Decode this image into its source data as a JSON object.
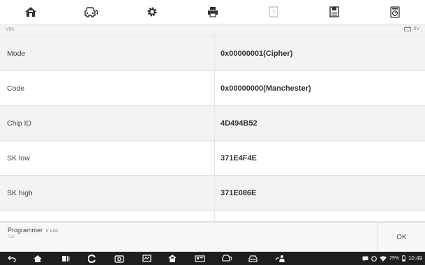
{
  "toolbar": {
    "icons": [
      "home-icon",
      "vehicle-swap-icon",
      "settings-icon",
      "print-icon",
      "help-icon",
      "save-icon",
      "datalogging-icon"
    ]
  },
  "vin_bar": {
    "vin_label": "VIN:",
    "voltage": "0V"
  },
  "rows": [
    {
      "label": "Mode",
      "value": "0x00000001(Cipher)"
    },
    {
      "label": "Code",
      "value": "0x00000000(Manchester)"
    },
    {
      "label": "Chip ID",
      "value": "4D494B52"
    },
    {
      "label": "SK low",
      "value": "371E4F4E"
    },
    {
      "label": "SK high",
      "value": "371E086E"
    }
  ],
  "footer": {
    "title": "Programmer",
    "version": "V 1.00",
    "car_label": "Car:",
    "ok_label": "OK"
  },
  "navbar": {
    "battery": "29%",
    "time": "10:49"
  },
  "colors": {
    "toolbar_icon": "#333333",
    "row_alt_bg": "#f3f3f3",
    "navbar_bg": "#1e1e1e"
  }
}
